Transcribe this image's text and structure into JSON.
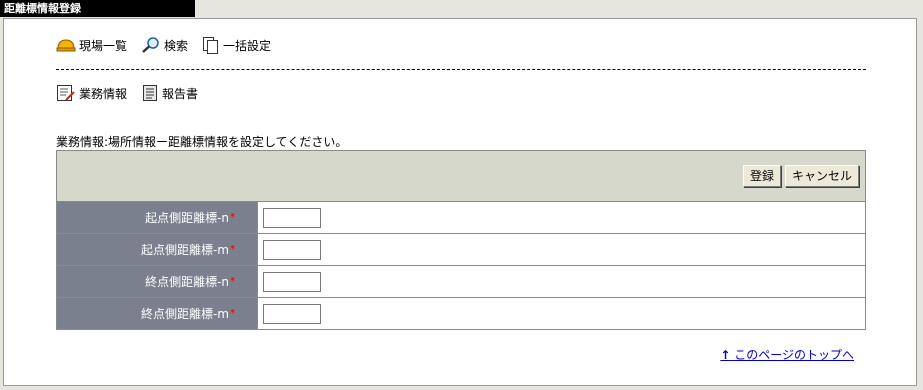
{
  "window": {
    "title": "距離標情報登録"
  },
  "toolbar": {
    "items": [
      {
        "label": "現場一覧",
        "icon": "helmet-icon"
      },
      {
        "label": "検索",
        "icon": "magnifier-icon"
      },
      {
        "label": "一括設定",
        "icon": "documents-icon"
      }
    ]
  },
  "toolbar2": {
    "items": [
      {
        "label": "業務情報",
        "icon": "edit-document-icon"
      },
      {
        "label": "報告書",
        "icon": "report-icon"
      }
    ]
  },
  "info": {
    "text": "業務情報:場所情報ー距離標情報を設定してください。"
  },
  "form": {
    "buttons": {
      "register": "登録",
      "cancel": "キャンセル"
    },
    "rows": [
      {
        "label": "起点側距離標-n",
        "required": "*",
        "value": ""
      },
      {
        "label": "起点側距離標-m",
        "required": "*",
        "value": ""
      },
      {
        "label": "終点側距離標-n",
        "required": "*",
        "value": ""
      },
      {
        "label": "終点側距離標-m",
        "required": "*",
        "value": ""
      }
    ]
  },
  "footer": {
    "arrow": "↑",
    "top_link": "このページのトップへ"
  },
  "colors": {
    "label_bg": "#7a808e",
    "head_bg": "#d6d8cc",
    "link": "#0000cc",
    "required": "#e00000"
  }
}
